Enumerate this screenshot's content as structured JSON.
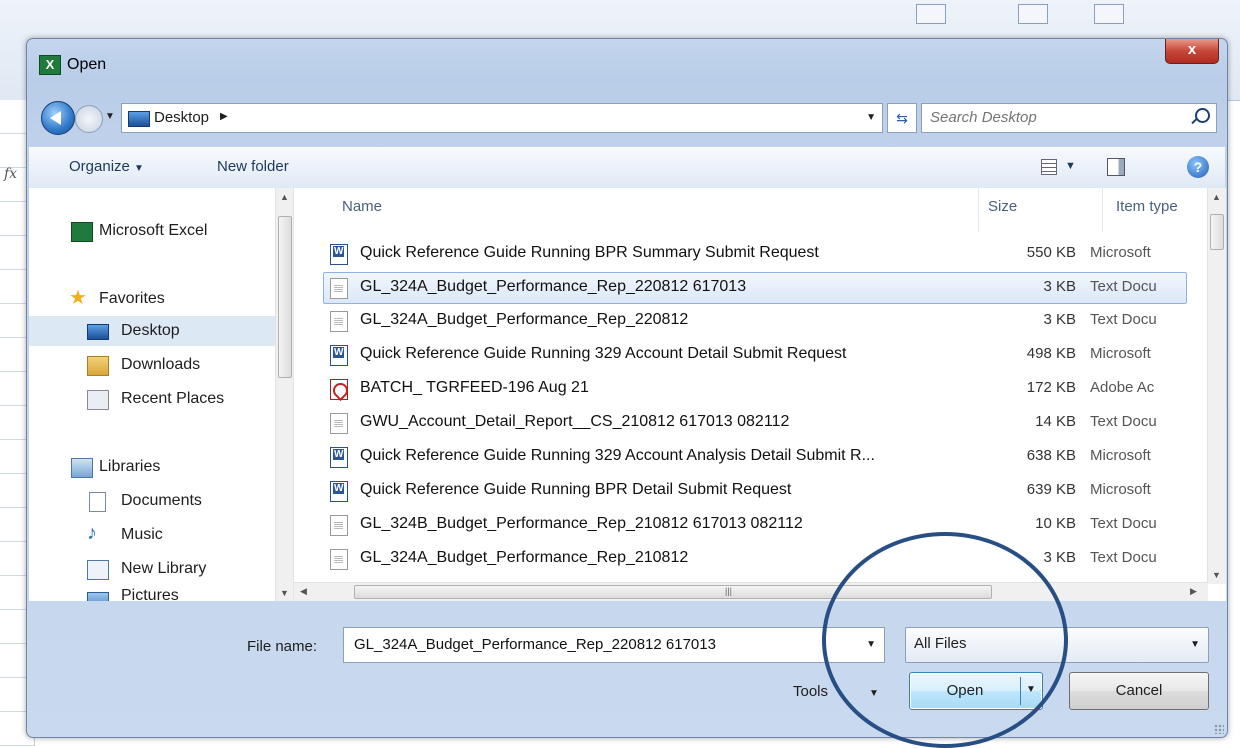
{
  "dialog": {
    "title": "Open",
    "close_label": "x"
  },
  "address": {
    "location": "Desktop",
    "search_placeholder": "Search Desktop"
  },
  "toolbar": {
    "organize_label": "Organize",
    "new_folder_label": "New folder",
    "help_label": "?"
  },
  "nav": {
    "items": [
      {
        "label": "Microsoft Excel",
        "icon": "excel-icon"
      },
      {
        "label": "Favorites",
        "icon": "star-icon"
      },
      {
        "label": "Desktop",
        "icon": "desktop-icon"
      },
      {
        "label": "Downloads",
        "icon": "downloads-folder-icon"
      },
      {
        "label": "Recent Places",
        "icon": "recent-places-icon"
      },
      {
        "label": "Libraries",
        "icon": "libraries-icon"
      },
      {
        "label": "Documents",
        "icon": "documents-icon"
      },
      {
        "label": "Music",
        "icon": "music-icon"
      },
      {
        "label": "New Library",
        "icon": "library-icon"
      },
      {
        "label": "Pictures",
        "icon": "pictures-icon"
      }
    ]
  },
  "columns": {
    "name": "Name",
    "size": "Size",
    "type": "Item type"
  },
  "files": [
    {
      "name": "Quick Reference Guide Running BPR Summary Submit Request",
      "size": "550 KB",
      "type": "Microsoft",
      "icon": "word-doc-icon"
    },
    {
      "name": "GL_324A_Budget_Performance_Rep_220812 617013",
      "size": "3 KB",
      "type": "Text Docu",
      "icon": "text-file-icon"
    },
    {
      "name": "GL_324A_Budget_Performance_Rep_220812",
      "size": "3 KB",
      "type": "Text Docu",
      "icon": "text-file-icon"
    },
    {
      "name": "Quick Reference Guide Running 329 Account Detail Submit Request",
      "size": "498 KB",
      "type": "Microsoft",
      "icon": "word-doc-icon"
    },
    {
      "name": "BATCH_ TGRFEED-196 Aug 21",
      "size": "172 KB",
      "type": "Adobe Ac",
      "icon": "pdf-icon"
    },
    {
      "name": "GWU_Account_Detail_Report__CS_210812 617013 082112",
      "size": "14 KB",
      "type": "Text Docu",
      "icon": "text-file-icon"
    },
    {
      "name": "Quick Reference Guide Running 329 Account Analysis Detail Submit R...",
      "size": "638 KB",
      "type": "Microsoft",
      "icon": "word-doc-icon"
    },
    {
      "name": "Quick Reference Guide Running BPR Detail Submit Request",
      "size": "639 KB",
      "type": "Microsoft",
      "icon": "word-doc-icon"
    },
    {
      "name": "GL_324B_Budget_Performance_Rep_210812 617013 082112",
      "size": "10 KB",
      "type": "Text Docu",
      "icon": "text-file-icon"
    },
    {
      "name": "GL_324A_Budget_Performance_Rep_210812",
      "size": "3 KB",
      "type": "Text Docu",
      "icon": "text-file-icon"
    }
  ],
  "bottom": {
    "file_name_label": "File name:",
    "file_name_value": "GL_324A_Budget_Performance_Rep_220812 617013",
    "filter_value": "All Files",
    "tools_label": "Tools",
    "open_label": "Open",
    "cancel_label": "Cancel"
  },
  "colors": {
    "accent": "#3c7fb1",
    "annotation_circle": "#274f86",
    "selection": "#dbe8f8"
  }
}
